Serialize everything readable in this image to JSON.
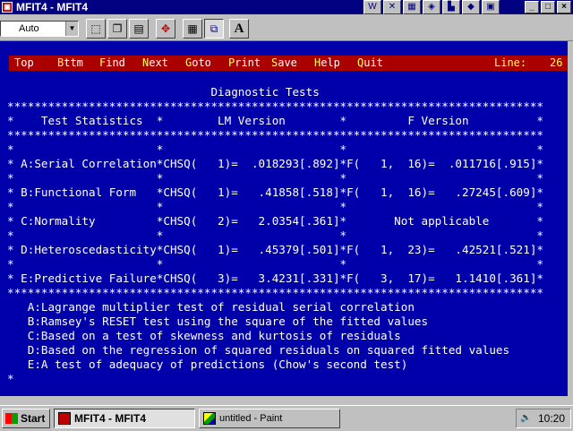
{
  "window": {
    "title": "MFIT4 - MFIT4",
    "app_icon": "MS-DOS",
    "controls": [
      "_",
      "□",
      "×"
    ]
  },
  "tray_icons": [
    "W",
    "✕",
    "▦",
    "◈",
    "▙",
    "◆",
    "▣"
  ],
  "toolbar": {
    "font_value": "Auto",
    "buttons": [
      "mark",
      "copy",
      "paste",
      "fullscreen",
      "properties",
      "background",
      "font"
    ],
    "font_button_label": "A"
  },
  "menu": {
    "items": [
      {
        "hot": "T",
        "rest": "op"
      },
      {
        "hot": "B",
        "rest": "ttm"
      },
      {
        "hot": "F",
        "rest": "ind"
      },
      {
        "hot": "N",
        "rest": "ext"
      },
      {
        "hot": "G",
        "rest": "oto"
      },
      {
        "hot": "P",
        "rest": "rint"
      },
      {
        "hot": "S",
        "rest": "ave"
      },
      {
        "hot": "H",
        "rest": "elp"
      },
      {
        "hot": "Q",
        "rest": "uit"
      }
    ],
    "line_label": "Line:",
    "line_value": "26"
  },
  "console_lines": [
    "                              Diagnostic Tests",
    "*******************************************************************************",
    "*    Test Statistics  *        LM Version        *         F Version          *",
    "*******************************************************************************",
    "*                     *                          *                            *",
    "* A:Serial Correlation*CHSQ(   1)=  .018293[.892]*F(   1,  16)=  .011716[.915]*",
    "*                     *                          *                            *",
    "* B:Functional Form   *CHSQ(   1)=   .41858[.518]*F(   1,  16)=   .27245[.609]*",
    "*                     *                          *                            *",
    "* C:Normality         *CHSQ(   2)=   2.0354[.361]*       Not applicable       *",
    "*                     *                          *                            *",
    "* D:Heteroscedasticity*CHSQ(   1)=   .45379[.501]*F(   1,  23)=   .42521[.521]*",
    "*                     *                          *                            *",
    "* E:Predictive Failure*CHSQ(   3)=   3.4231[.331]*F(   3,  17)=   1.1410[.361]*",
    "*******************************************************************************",
    "   A:Lagrange multiplier test of residual serial correlation",
    "   B:Ramsey's RESET test using the square of the fitted values",
    "   C:Based on a test of skewness and kurtosis of residuals",
    "   D:Based on the regression of squared residuals on squared fitted values",
    "   E:A test of adequacy of predictions (Chow's second test)",
    "*"
  ],
  "taskbar": {
    "start_label": "Start",
    "tasks": [
      {
        "label": "MFIT4 - MFIT4",
        "active": true
      },
      {
        "label": "untitled - Paint",
        "active": false
      }
    ],
    "clock": "10:20"
  },
  "colors": {
    "console_bg": "#0000aa",
    "menu_bg": "#aa0000",
    "menu_hotkey": "#ffff55",
    "titlebar": "#000080"
  }
}
